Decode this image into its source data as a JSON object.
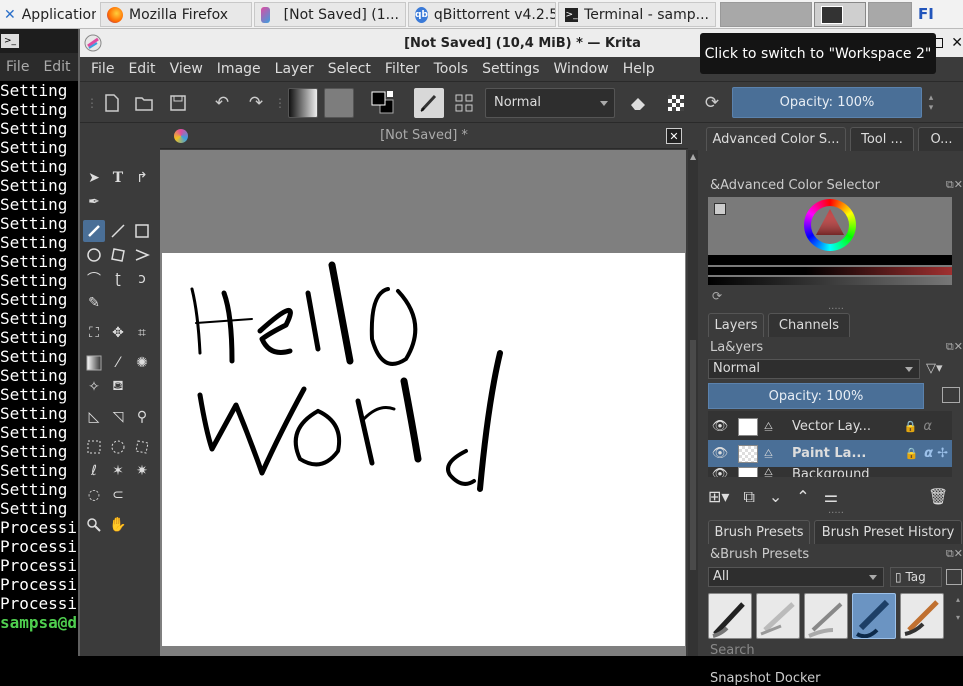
{
  "taskbar": {
    "applications_label": "Applications",
    "firefox_label": "Mozilla Firefox",
    "krita_label": "[Not Saved]  (1...",
    "qbittorrent_label": "qBittorrent v4.2.5",
    "terminal_label": "Terminal - samp...",
    "keyboard_layout": "FI"
  },
  "terminal": {
    "menu": [
      "File",
      "Edit"
    ],
    "lines": [
      "Setting",
      "Setting",
      "Setting",
      "Setting",
      "Setting",
      "Setting",
      "Setting",
      "Setting",
      "Setting",
      "Setting",
      "Setting",
      "Setting",
      "Setting",
      "Setting",
      "Setting",
      "Setting",
      "Setting",
      "Setting",
      "Setting",
      "Setting",
      "Setting",
      "Setting",
      "Setting",
      "Processi",
      "Processi",
      "Processi",
      "Processi",
      "Processi"
    ],
    "prompt": "sampsa@d"
  },
  "krita": {
    "title": "[Not Saved]  (10,4 MiB)  * — Krita",
    "tooltip": "Click to switch to \"Workspace 2\"",
    "menu": [
      "File",
      "Edit",
      "View",
      "Image",
      "Layer",
      "Select",
      "Filter",
      "Tools",
      "Settings",
      "Window",
      "Help"
    ],
    "blend_mode": "Normal",
    "opacity_label": "Opacity:  100%",
    "document_tab": "[Not Saved]  *",
    "canvas_text": [
      "Hello",
      "world"
    ]
  },
  "docker": {
    "tabs_top": [
      "Advanced Color S...",
      "Tool ...",
      "O..."
    ],
    "color_selector_title": "&Advanced Color Selector",
    "layer_tabs": [
      "Layers",
      "Channels"
    ],
    "layers_title": "La&yers",
    "layer_blend": "Normal",
    "layer_opacity": "Opacity:  100%",
    "layers": [
      "Vector Lay...",
      "Paint La...",
      "Background"
    ],
    "brush_tabs": [
      "Brush Presets",
      "Brush Preset History"
    ],
    "brush_presets_title": "&Brush Presets",
    "brush_filter": "All",
    "tag_label": "Tag",
    "search_placeholder": "Search",
    "snapshot_title": "Snapshot Docker"
  },
  "colors": {
    "accent": "#4a6f97",
    "panel": "#3b3b3b",
    "terminal_prompt": "#4fcf4f"
  }
}
